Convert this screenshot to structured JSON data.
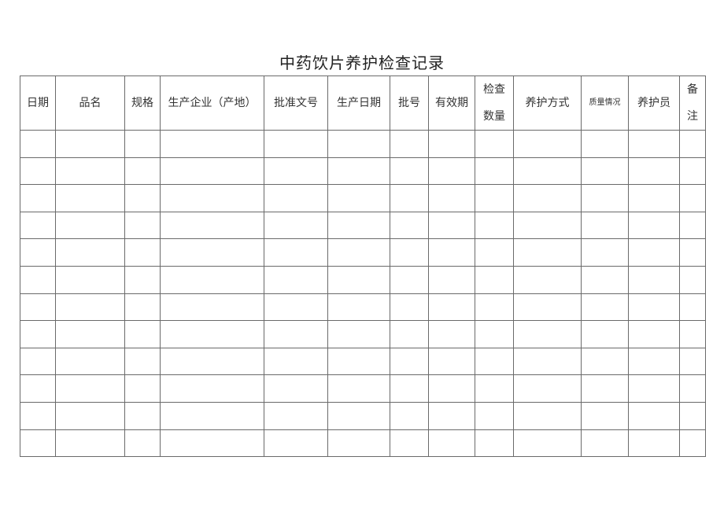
{
  "document": {
    "title": "中药饮片养护检查记录",
    "table": {
      "columns": [
        {
          "key": "date",
          "label": "日期"
        },
        {
          "key": "product_name",
          "label": "品名"
        },
        {
          "key": "specification",
          "label": "规格"
        },
        {
          "key": "manufacturer",
          "label": "生产企业（产地）"
        },
        {
          "key": "approval_number",
          "label": "批准文号"
        },
        {
          "key": "production_date",
          "label": "生产日期"
        },
        {
          "key": "batch_number",
          "label": "批号"
        },
        {
          "key": "expiry_date",
          "label": "有效期"
        },
        {
          "key": "inspected_quantity",
          "label": "检查数量",
          "lines": [
            "检查",
            "数量"
          ]
        },
        {
          "key": "maintenance_method",
          "label": "养护方式"
        },
        {
          "key": "quality_status",
          "label": "质量情况"
        },
        {
          "key": "maintainer",
          "label": "养护员"
        },
        {
          "key": "remarks",
          "label": "备注",
          "lines": [
            "备",
            "注"
          ]
        }
      ],
      "rows": [
        [
          "",
          "",
          "",
          "",
          "",
          "",
          "",
          "",
          "",
          "",
          "",
          "",
          ""
        ],
        [
          "",
          "",
          "",
          "",
          "",
          "",
          "",
          "",
          "",
          "",
          "",
          "",
          ""
        ],
        [
          "",
          "",
          "",
          "",
          "",
          "",
          "",
          "",
          "",
          "",
          "",
          "",
          ""
        ],
        [
          "",
          "",
          "",
          "",
          "",
          "",
          "",
          "",
          "",
          "",
          "",
          "",
          ""
        ],
        [
          "",
          "",
          "",
          "",
          "",
          "",
          "",
          "",
          "",
          "",
          "",
          "",
          ""
        ],
        [
          "",
          "",
          "",
          "",
          "",
          "",
          "",
          "",
          "",
          "",
          "",
          "",
          ""
        ],
        [
          "",
          "",
          "",
          "",
          "",
          "",
          "",
          "",
          "",
          "",
          "",
          "",
          ""
        ],
        [
          "",
          "",
          "",
          "",
          "",
          "",
          "",
          "",
          "",
          "",
          "",
          "",
          ""
        ],
        [
          "",
          "",
          "",
          "",
          "",
          "",
          "",
          "",
          "",
          "",
          "",
          "",
          ""
        ],
        [
          "",
          "",
          "",
          "",
          "",
          "",
          "",
          "",
          "",
          "",
          "",
          "",
          ""
        ],
        [
          "",
          "",
          "",
          "",
          "",
          "",
          "",
          "",
          "",
          "",
          "",
          "",
          ""
        ],
        [
          "",
          "",
          "",
          "",
          "",
          "",
          "",
          "",
          "",
          "",
          "",
          "",
          ""
        ]
      ]
    }
  }
}
